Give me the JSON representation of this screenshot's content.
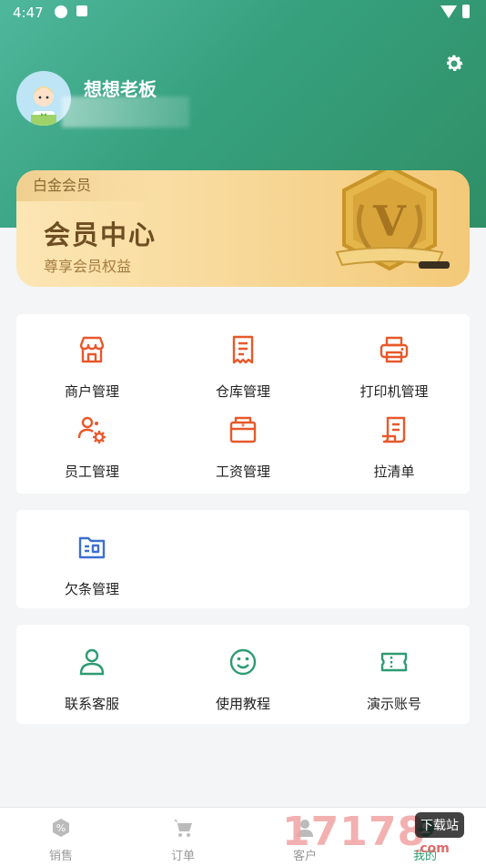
{
  "status_bar": {
    "time": "4:47"
  },
  "profile": {
    "name": "想想老板"
  },
  "vip": {
    "tag": "白金会员",
    "title": "会员中心",
    "subtitle": "尊享会员权益",
    "badge_letter": "V"
  },
  "accent": "#e8582a",
  "blue": "#3d6fd1",
  "green": "#2f9b72",
  "section1": [
    {
      "label": "商户管理",
      "icon": "store-icon"
    },
    {
      "label": "仓库管理",
      "icon": "receipt-icon"
    },
    {
      "label": "打印机管理",
      "icon": "printer-icon"
    },
    {
      "label": "员工管理",
      "icon": "staff-icon"
    },
    {
      "label": "工资管理",
      "icon": "salary-icon"
    },
    {
      "label": "拉清单",
      "icon": "list-icon"
    }
  ],
  "section2": [
    {
      "label": "欠条管理",
      "icon": "folder-icon"
    }
  ],
  "section3": [
    {
      "label": "联系客服",
      "icon": "person-icon"
    },
    {
      "label": "使用教程",
      "icon": "smile-icon"
    },
    {
      "label": "演示账号",
      "icon": "ticket-icon"
    }
  ],
  "tabs": [
    {
      "label": "销售",
      "icon": "percent-icon"
    },
    {
      "label": "订单",
      "icon": "cart-icon"
    },
    {
      "label": "客户",
      "icon": "customer-icon"
    },
    {
      "label": "我的",
      "icon": "me-icon"
    }
  ],
  "watermark": {
    "number": "17178",
    "site": "下载站",
    "domain": ".com"
  }
}
